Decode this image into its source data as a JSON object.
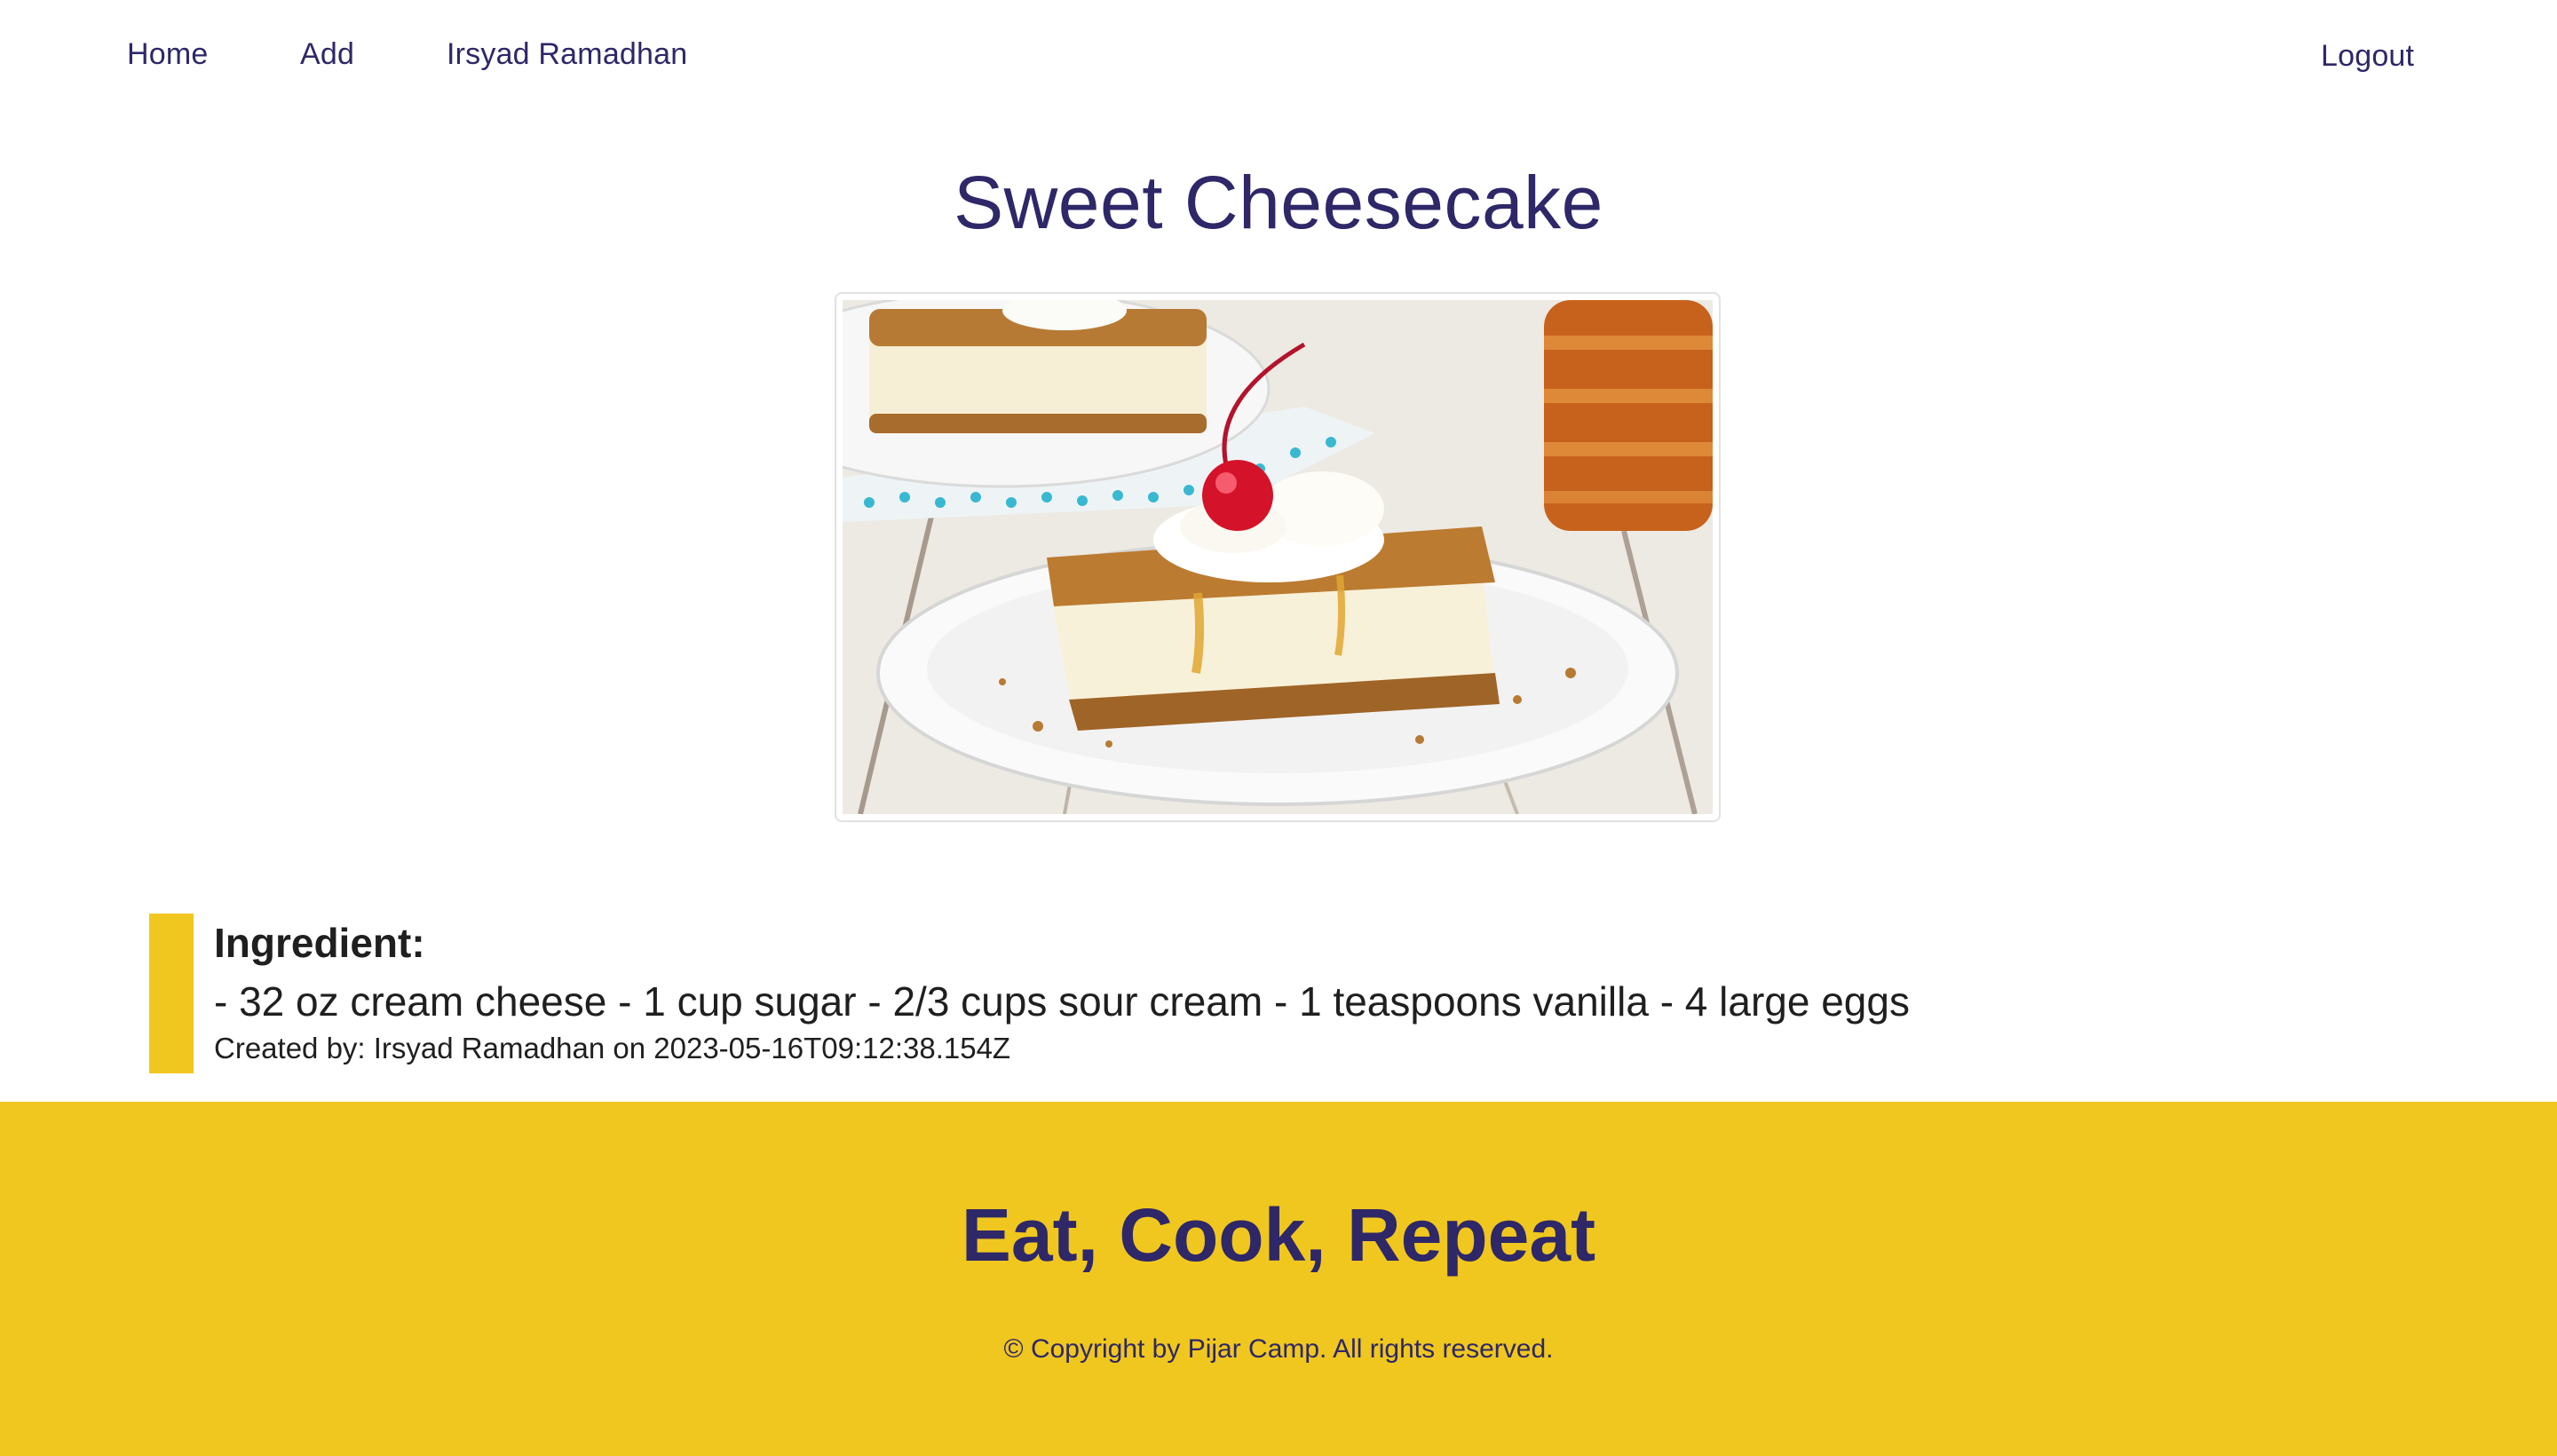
{
  "nav": {
    "home_label": "Home",
    "add_label": "Add",
    "user_label": "Irsyad Ramadhan",
    "logout_label": "Logout"
  },
  "recipe": {
    "title": "Sweet Cheesecake",
    "ingredient_heading": "Ingredient:",
    "ingredients_text": "- 32 oz cream cheese - 1 cup sugar - 2/3 cups sour cream - 1 teaspoons vanilla - 4 large eggs",
    "created_text": "Created by: Irsyad Ramadhan on 2023-05-16T09:12:38.154Z"
  },
  "footer": {
    "tagline": "Eat, Cook, Repeat",
    "copyright": "© Copyright by Pijar Camp. All rights reserved."
  },
  "colors": {
    "brand_navy": "#2e2768",
    "accent_yellow": "#f0c71e",
    "text_dark": "#1f1f1f"
  }
}
